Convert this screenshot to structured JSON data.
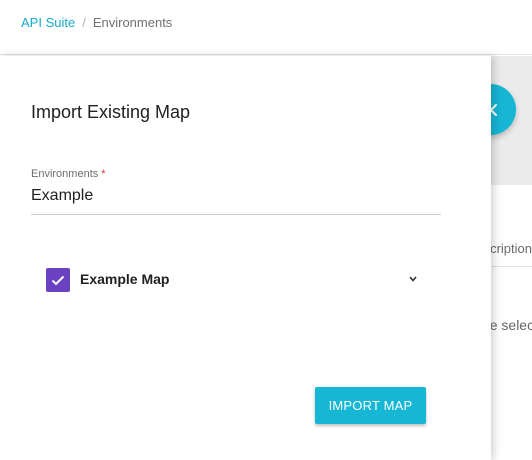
{
  "header": {
    "breadcrumb": {
      "root": "API Suite",
      "separator": "/",
      "current": "Environments"
    }
  },
  "background": {
    "column_header": "Description",
    "empty_message": "Please select"
  },
  "fab": {
    "icon": "close-icon"
  },
  "drawer": {
    "title": "Import Existing Map",
    "environments_field": {
      "label": "Environments",
      "required_mark": "*",
      "value": "Example"
    },
    "maps": [
      {
        "label": "Example Map",
        "checked": true,
        "icon": "chevron-down-icon"
      }
    ],
    "import_button_label": "IMPORT MAP"
  },
  "colors": {
    "accent": "#16b6d5",
    "link": "#16a9c9",
    "checkbox": "#6a41c0",
    "required": "#e53935"
  }
}
